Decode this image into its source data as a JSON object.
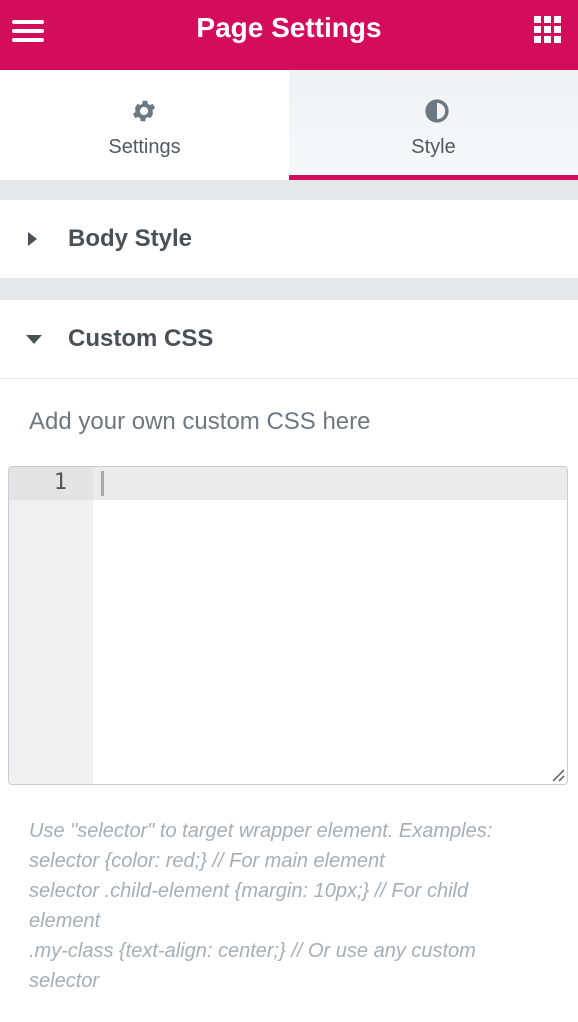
{
  "header": {
    "title": "Page Settings",
    "menu_icon": "hamburger-menu-icon",
    "apps_icon": "apps-grid-icon",
    "color": "#d30c5c"
  },
  "tabs": [
    {
      "label": "Settings",
      "icon": "gear-icon",
      "active": false
    },
    {
      "label": "Style",
      "icon": "contrast-icon",
      "active": true
    }
  ],
  "sections": {
    "body_style": {
      "title": "Body Style",
      "expanded": false,
      "icon": "caret-right-icon"
    },
    "custom_css": {
      "title": "Custom CSS",
      "expanded": true,
      "icon": "caret-down-icon"
    }
  },
  "custom_css": {
    "description": "Add your own custom CSS here",
    "editor": {
      "line_numbers": [
        "1"
      ],
      "content": ""
    },
    "help_lines": [
      "Use \"selector\" to target wrapper element. Examples:",
      "selector {color: red;} // For main element",
      "selector .child-element {margin: 10px;} // For child",
      "element",
      ".my-class {text-align: center;} // Or use any custom",
      "selector"
    ]
  }
}
